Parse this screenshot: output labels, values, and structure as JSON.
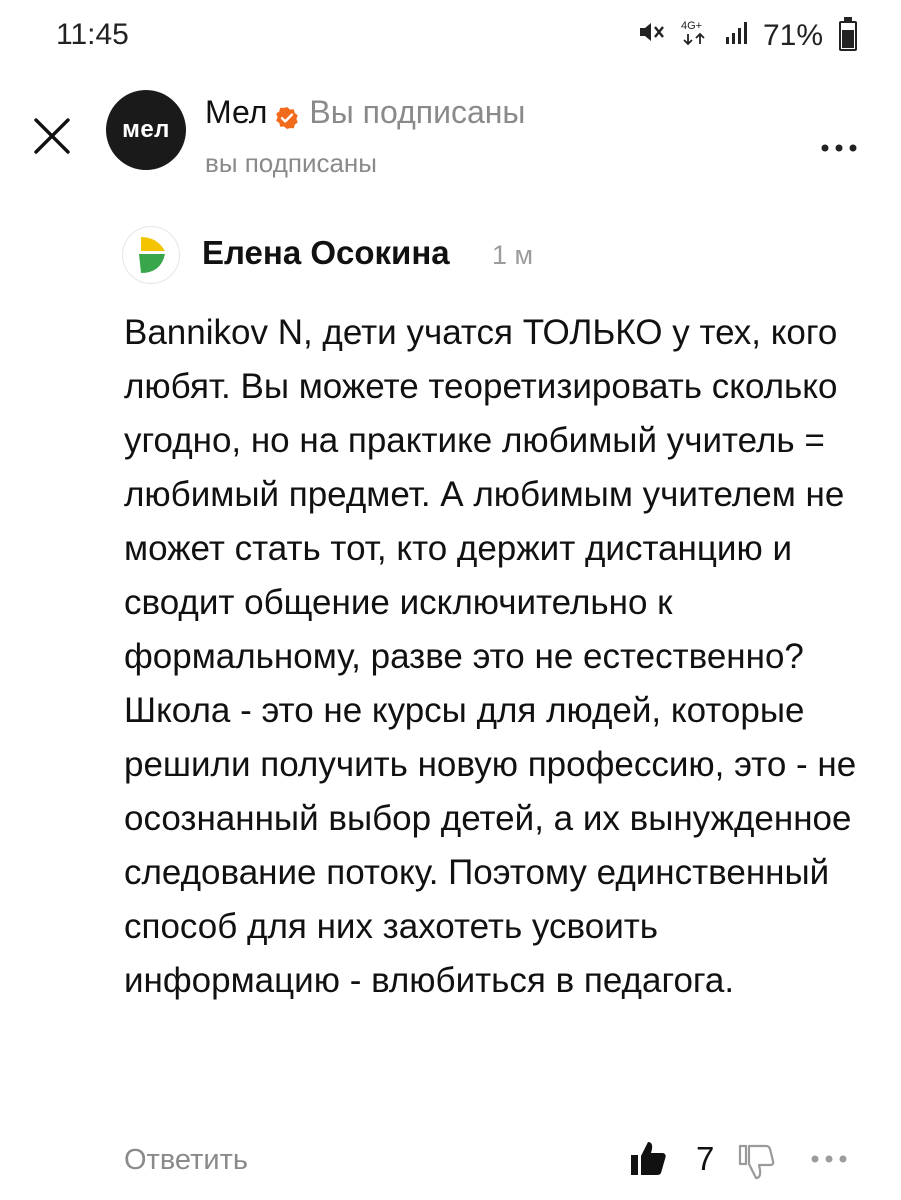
{
  "status_bar": {
    "time": "11:45",
    "network": "4G+",
    "battery": "71%"
  },
  "header": {
    "channel_avatar_text": "мел",
    "channel_name": "Мел",
    "subscribed_label": "Вы подписаны",
    "subscribed_subtitle": "вы подписаны",
    "icons": {
      "close": "close-icon",
      "verified": "verified-icon",
      "more": "more-icon"
    },
    "colors": {
      "verified": "#f26b1d",
      "avatar_bg": "#1a1a1a"
    }
  },
  "comment": {
    "author": "Елена Осокина",
    "time": "1 м",
    "text": "Bannikov N, дети учатся ТОЛЬКО у тех, кого любят. Вы можете теоретизировать сколько угодно, но на практике любимый учитель = любимый предмет. А любимым учителем не может стать тот, кто держит дистанцию и сводит общение исключительно к формальному, разве это не естественно? Школа - это не курсы для людей, которые решили получить новую профессию, это - не осознанный выбор детей, а их вынужденное следование потоку. Поэтому единственный способ для них захотеть усвоить информацию - влюбиться в педагога.",
    "reply_label": "Ответить",
    "like_count": "7",
    "icons": {
      "like": "thumbs-up-icon",
      "dislike": "thumbs-down-icon",
      "more": "more-icon"
    }
  }
}
